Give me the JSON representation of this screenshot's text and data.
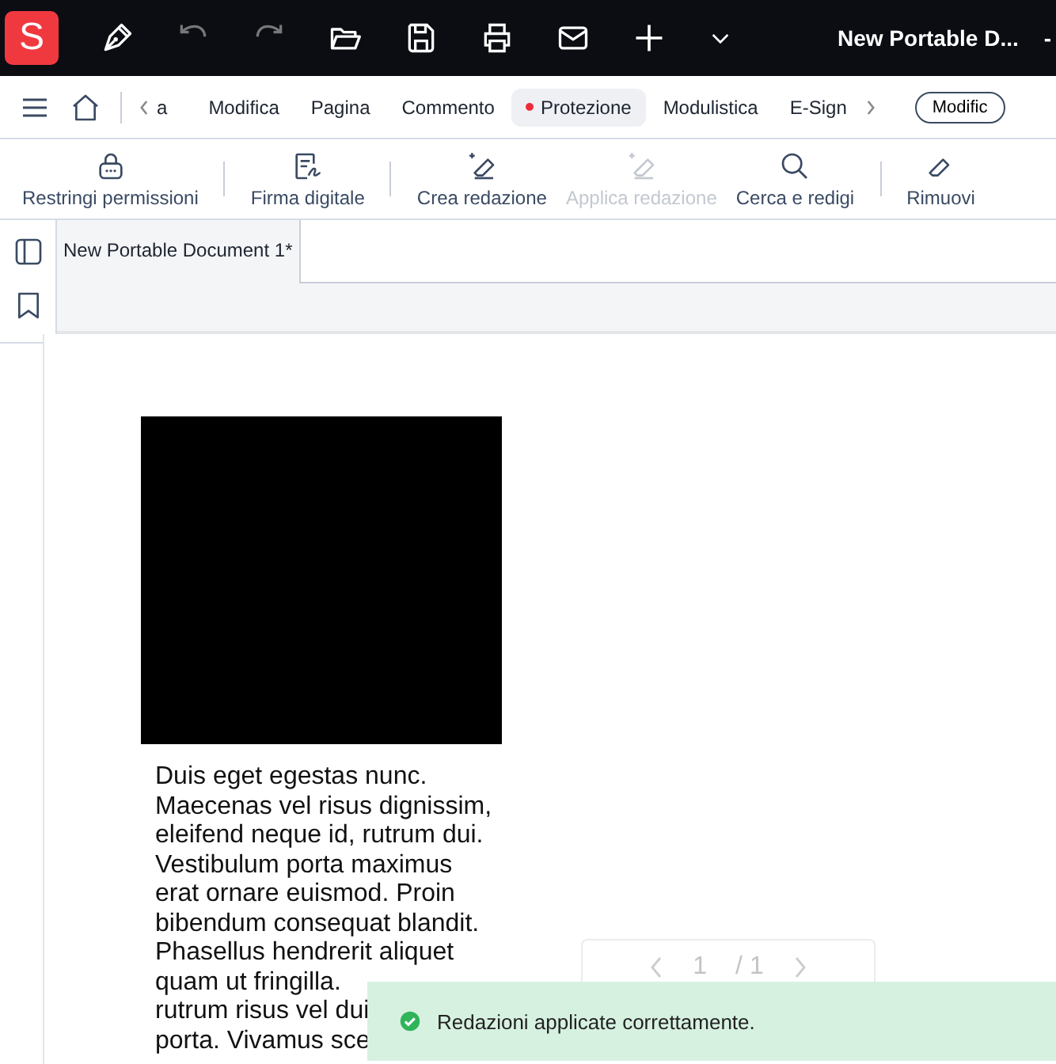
{
  "app": {
    "logo": "S",
    "title": "New Portable D...",
    "title_extra": "-"
  },
  "ribbon_tabs": [
    {
      "label": "a",
      "selected": false,
      "dot": false
    },
    {
      "label": "Modifica",
      "selected": false,
      "dot": false
    },
    {
      "label": "Pagina",
      "selected": false,
      "dot": false
    },
    {
      "label": "Commento",
      "selected": false,
      "dot": false
    },
    {
      "label": "Protezione",
      "selected": true,
      "dot": true
    },
    {
      "label": "Modulistica",
      "selected": false,
      "dot": false
    },
    {
      "label": "E-Sign",
      "selected": false,
      "dot": false
    }
  ],
  "mode_button": "Modific",
  "tools": [
    {
      "kind": "lock",
      "label": "Restringi permissioni",
      "disabled": false
    },
    {
      "kind": "sign",
      "label": "Firma digitale",
      "disabled": false
    },
    {
      "kind": "redact",
      "label": "Crea redazione",
      "disabled": false
    },
    {
      "kind": "redact",
      "label": "Applica redazione",
      "disabled": true
    },
    {
      "kind": "search",
      "label": "Cerca e redigi",
      "disabled": false
    },
    {
      "kind": "eraser",
      "label": "Rimuovi",
      "disabled": false
    }
  ],
  "document_tab": {
    "label": "New Portable Document 1*"
  },
  "document": {
    "lines": [
      "Duis eget egestas nunc.",
      "Maecenas vel risus dignissim,",
      "eleifend neque id, rutrum dui.",
      "Vestibulum porta maximus",
      "erat ornare euismod. Proin",
      "bibendum consequat blandit.",
      "Phasellus hendrerit aliquet",
      "quam ut fringilla.",
      "rutrum risus vel dui",
      "porta. Vivamus sce"
    ]
  },
  "page_nav": {
    "current": "1",
    "total": "/ 1"
  },
  "toast": {
    "message": "Redazioni applicate correttamente."
  }
}
